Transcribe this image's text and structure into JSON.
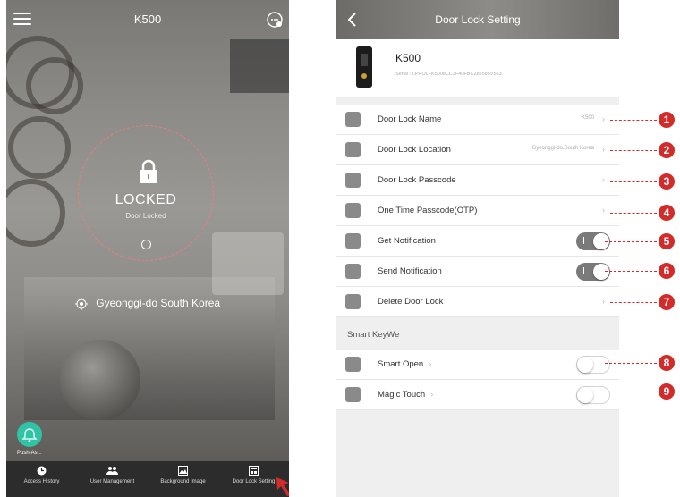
{
  "left": {
    "title": "K500",
    "lock_status": "LOCKED",
    "lock_substatus": "Door Locked",
    "location": "Gyeonggi-do  South Korea",
    "push_label": "Push-As...",
    "nav": [
      {
        "label": "Access History",
        "icon": "clock-icon"
      },
      {
        "label": "User Management",
        "icon": "users-icon"
      },
      {
        "label": "Background Image",
        "icon": "image-icon"
      },
      {
        "label": "Door Lock Setting",
        "icon": "settings-icon"
      }
    ]
  },
  "right": {
    "title": "Door Lock Setting",
    "device": {
      "name": "K500",
      "serial": "Serial : LPROLFK5008CC3F40FBC285585V563"
    },
    "settings": [
      {
        "label": "Door Lock Name",
        "value": "K500",
        "control": "chevron"
      },
      {
        "label": "Door Lock Location",
        "value": "Gyeonggi-do,South Korea",
        "control": "chevron"
      },
      {
        "label": "Door Lock Passcode",
        "value": "",
        "control": "chevron"
      },
      {
        "label": "One Time Passcode(OTP)",
        "value": "",
        "control": "chevron"
      },
      {
        "label": "Get Notification",
        "value": "",
        "control": "toggle",
        "state": "on"
      },
      {
        "label": "Send Notification",
        "value": "",
        "control": "toggle",
        "state": "on"
      },
      {
        "label": "Delete Door Lock",
        "value": "",
        "control": "chevron"
      }
    ],
    "section_title": "Smart KeyWe",
    "smart": [
      {
        "label": "Smart Open",
        "control": "toggle",
        "state": "off"
      },
      {
        "label": "Magic Touch",
        "control": "toggle",
        "state": "off"
      }
    ]
  },
  "callouts": [
    "1",
    "2",
    "3",
    "4",
    "5",
    "6",
    "7",
    "8",
    "9"
  ],
  "colors": {
    "accent_red": "#d32a2a",
    "push_green": "#2ec4a5",
    "toggle_on": "#7a7a7a"
  }
}
